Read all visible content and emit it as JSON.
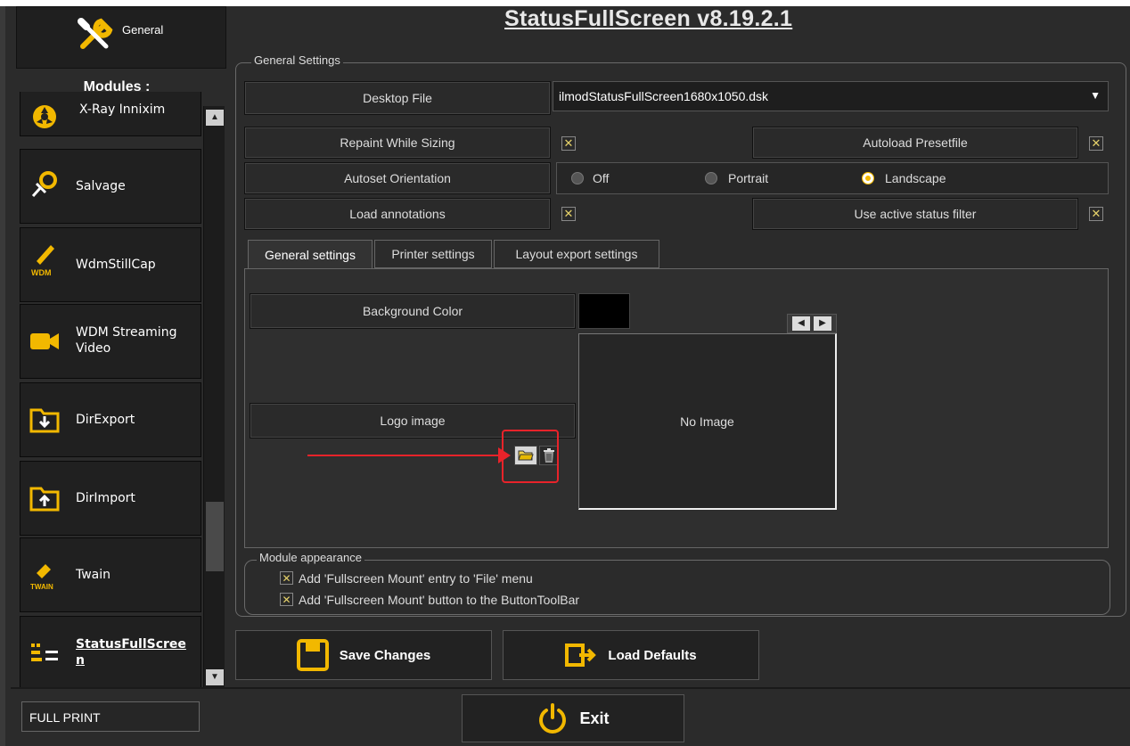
{
  "app": {
    "title": "StatusFullScreen v8.19.2.1"
  },
  "sidebar": {
    "general_label": "General",
    "modules_title": "Modules :",
    "modules": [
      {
        "label": "X-Ray Innixim",
        "icon": "xray-icon"
      },
      {
        "label": "Salvage",
        "icon": "salvage-icon"
      },
      {
        "label": "WdmStillCap",
        "icon": "wdm-icon"
      },
      {
        "label": "WDM Streaming Video",
        "icon": "video-camera-icon"
      },
      {
        "label": "DirExport",
        "icon": "folder-export-icon"
      },
      {
        "label": "DirImport",
        "icon": "folder-import-icon"
      },
      {
        "label": "Twain",
        "icon": "twain-icon"
      },
      {
        "label": "StatusFullScreen",
        "icon": "status-fullscreen-icon"
      }
    ],
    "wdm_badge": "WDM",
    "twain_badge": "TWAIN"
  },
  "general_settings": {
    "legend": "General Settings",
    "desktop_file_label": "Desktop File",
    "desktop_file_value": "ilmodStatusFullScreen1680x1050.dsk",
    "repaint_label": "Repaint While Sizing",
    "repaint_checked": true,
    "autoload_label": "Autoload Presetfile",
    "autoload_checked": true,
    "orientation_label": "Autoset Orientation",
    "orientation_options": [
      "Off",
      "Portrait",
      "Landscape"
    ],
    "orientation_selected": "Landscape",
    "annotations_label": "Load annotations",
    "annotations_checked": true,
    "status_filter_label": "Use active status filter",
    "status_filter_checked": true
  },
  "tabs": [
    "General settings",
    "Printer settings",
    "Layout export settings"
  ],
  "active_tab": "General settings",
  "tab_general": {
    "bg_color_label": "Background Color",
    "bg_color": "#000000",
    "logo_label": "Logo image",
    "no_image": "No Image"
  },
  "appearance": {
    "legend": "Module appearance",
    "options": [
      {
        "label": "Add 'Fullscreen Mount' entry to 'File' menu",
        "checked": true
      },
      {
        "label": "Add 'Fullscreen Mount' button to the ButtonToolBar",
        "checked": true
      }
    ]
  },
  "actions": {
    "save": "Save Changes",
    "load_defaults": "Load Defaults",
    "exit": "Exit"
  },
  "footer": {
    "status": "FULL PRINT"
  },
  "colors": {
    "accent": "#f2b800",
    "annotation": "#e8232a"
  }
}
